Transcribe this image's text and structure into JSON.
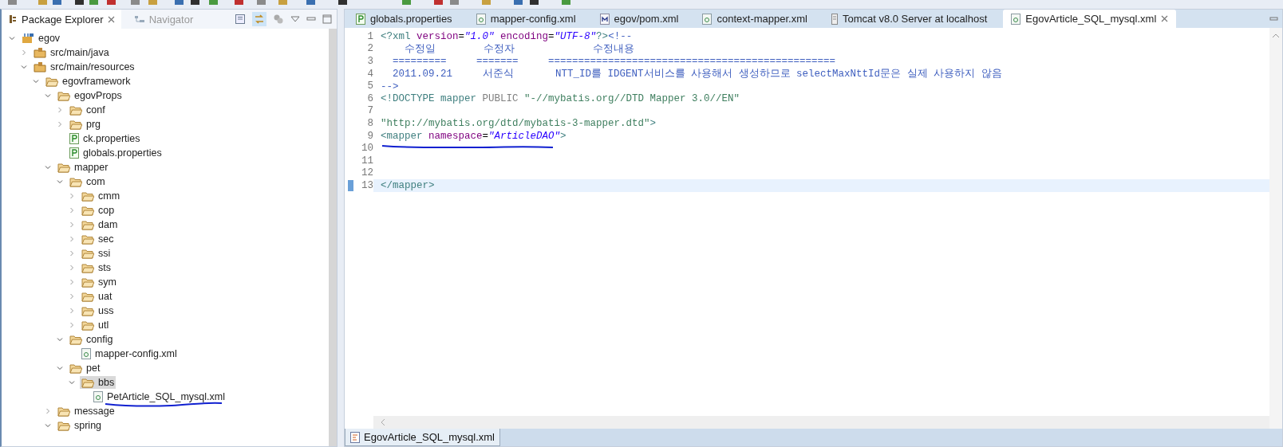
{
  "explorer": {
    "tabs": [
      {
        "label": "Package Explorer",
        "selected": true
      },
      {
        "label": "Navigator",
        "selected": false
      }
    ],
    "tree": [
      {
        "label": "egov",
        "kind": "project",
        "expanded": true,
        "selected": false,
        "children": [
          {
            "label": "src/main/java",
            "kind": "source",
            "expanded": false,
            "selected": false
          },
          {
            "label": "src/main/resources",
            "kind": "source",
            "expanded": true,
            "selected": false,
            "children": [
              {
                "label": "egovframework",
                "kind": "folder",
                "expanded": true,
                "selected": false,
                "children": [
                  {
                    "label": "egovProps",
                    "kind": "folder",
                    "expanded": true,
                    "selected": false,
                    "children": [
                      {
                        "label": "conf",
                        "kind": "folder",
                        "expanded": false,
                        "selected": false
                      },
                      {
                        "label": "prg",
                        "kind": "folder",
                        "expanded": false,
                        "selected": false
                      },
                      {
                        "label": "ck.properties",
                        "kind": "properties",
                        "selected": false
                      },
                      {
                        "label": "globals.properties",
                        "kind": "properties",
                        "selected": false
                      }
                    ]
                  },
                  {
                    "label": "mapper",
                    "kind": "folder",
                    "expanded": true,
                    "selected": false,
                    "children": [
                      {
                        "label": "com",
                        "kind": "folder",
                        "expanded": true,
                        "selected": false,
                        "children": [
                          {
                            "label": "cmm",
                            "kind": "folder",
                            "expanded": false,
                            "selected": false
                          },
                          {
                            "label": "cop",
                            "kind": "folder",
                            "expanded": false,
                            "selected": false
                          },
                          {
                            "label": "dam",
                            "kind": "folder",
                            "expanded": false,
                            "selected": false
                          },
                          {
                            "label": "sec",
                            "kind": "folder",
                            "expanded": false,
                            "selected": false
                          },
                          {
                            "label": "ssi",
                            "kind": "folder",
                            "expanded": false,
                            "selected": false
                          },
                          {
                            "label": "sts",
                            "kind": "folder",
                            "expanded": false,
                            "selected": false
                          },
                          {
                            "label": "sym",
                            "kind": "folder",
                            "expanded": false,
                            "selected": false
                          },
                          {
                            "label": "uat",
                            "kind": "folder",
                            "expanded": false,
                            "selected": false
                          },
                          {
                            "label": "uss",
                            "kind": "folder",
                            "expanded": false,
                            "selected": false
                          },
                          {
                            "label": "utl",
                            "kind": "folder",
                            "expanded": false,
                            "selected": false
                          }
                        ]
                      },
                      {
                        "label": "config",
                        "kind": "folder",
                        "expanded": true,
                        "selected": false,
                        "children": [
                          {
                            "label": "mapper-config.xml",
                            "kind": "xml",
                            "selected": false
                          }
                        ]
                      },
                      {
                        "label": "pet",
                        "kind": "folder",
                        "expanded": true,
                        "selected": false,
                        "children": [
                          {
                            "label": "bbs",
                            "kind": "folder",
                            "expanded": true,
                            "selected": true,
                            "children": [
                              {
                                "label": "PetArticle_SQL_mysql.xml",
                                "kind": "xml",
                                "selected": false,
                                "underlined": true
                              }
                            ]
                          }
                        ]
                      }
                    ]
                  },
                  {
                    "label": "message",
                    "kind": "folder",
                    "expanded": false,
                    "selected": false
                  },
                  {
                    "label": "spring",
                    "kind": "folder",
                    "expanded": true,
                    "selected": false
                  }
                ]
              }
            ]
          }
        ]
      }
    ]
  },
  "editor": {
    "tabs": [
      {
        "label": "globals.properties",
        "kind": "properties",
        "selected": false
      },
      {
        "label": "mapper-config.xml",
        "kind": "xml",
        "selected": false
      },
      {
        "label": "egov/pom.xml",
        "kind": "maven",
        "selected": false
      },
      {
        "label": "context-mapper.xml",
        "kind": "xml",
        "selected": false
      },
      {
        "label": "Tomcat v8.0 Server at localhost",
        "kind": "server",
        "selected": false
      },
      {
        "label": "EgovArticle_SQL_mysql.xml",
        "kind": "xml",
        "selected": true
      }
    ],
    "lines": [
      {
        "number": "1",
        "current": false,
        "tokens": [
          {
            "kind": "tag",
            "text": "<?xml"
          },
          {
            "kind": "attr",
            "text": " version"
          },
          {
            "kind": "plain",
            "text": "="
          },
          {
            "kind": "value",
            "text": "\"1.0\""
          },
          {
            "kind": "attr",
            "text": " encoding"
          },
          {
            "kind": "plain",
            "text": "="
          },
          {
            "kind": "value",
            "text": "\"UTF-8\""
          },
          {
            "kind": "tag",
            "text": "?>"
          },
          {
            "kind": "comment",
            "text": "<!--"
          }
        ]
      },
      {
        "number": "2",
        "current": false,
        "tokens": [
          {
            "kind": "comment",
            "text": "    수정일        수정자             수정내용"
          }
        ]
      },
      {
        "number": "3",
        "current": false,
        "tokens": [
          {
            "kind": "comment",
            "text": "  =========     =======     ================================================"
          }
        ]
      },
      {
        "number": "4",
        "current": false,
        "tokens": [
          {
            "kind": "comment",
            "text": "  2011.09.21     서준식       NTT_ID를 IDGENT서비스를 사용해서 생성하므로 selectMaxNttId문은 실제 사용하지 않음"
          }
        ]
      },
      {
        "number": "5",
        "current": false,
        "tokens": [
          {
            "kind": "comment",
            "text": "-->"
          }
        ]
      },
      {
        "number": "6",
        "current": false,
        "tokens": [
          {
            "kind": "tag",
            "text": "<!DOCTYPE mapper"
          },
          {
            "kind": "keyword",
            "text": " PUBLIC"
          },
          {
            "kind": "doctype",
            "text": " \"-//mybatis.org//DTD Mapper 3.0//EN\""
          }
        ]
      },
      {
        "number": "7",
        "current": false
      },
      {
        "number": "8",
        "current": false,
        "tokens": [
          {
            "kind": "doctype",
            "text": "\"http://mybatis.org/dtd/mybatis-3-mapper.dtd\""
          },
          {
            "kind": "tag",
            "text": ">"
          }
        ]
      },
      {
        "number": "9",
        "current": false,
        "tokens": [
          {
            "kind": "tag",
            "text": "<mapper"
          },
          {
            "kind": "attr",
            "text": " namespace"
          },
          {
            "kind": "plain",
            "text": "="
          },
          {
            "kind": "value",
            "text": "\"ArticleDAO\""
          },
          {
            "kind": "tag",
            "text": ">"
          }
        ]
      },
      {
        "number": "10",
        "current": false,
        "underlined": true
      },
      {
        "number": "11",
        "current": false
      },
      {
        "number": "12",
        "current": false
      },
      {
        "number": "13",
        "current": true,
        "tokens": [
          {
            "kind": "tag",
            "text": "</mapper>"
          }
        ]
      }
    ],
    "bottom_tabs": [
      {
        "label": "EgovArticle_SQL_mysql.xml",
        "selected": true
      }
    ]
  }
}
